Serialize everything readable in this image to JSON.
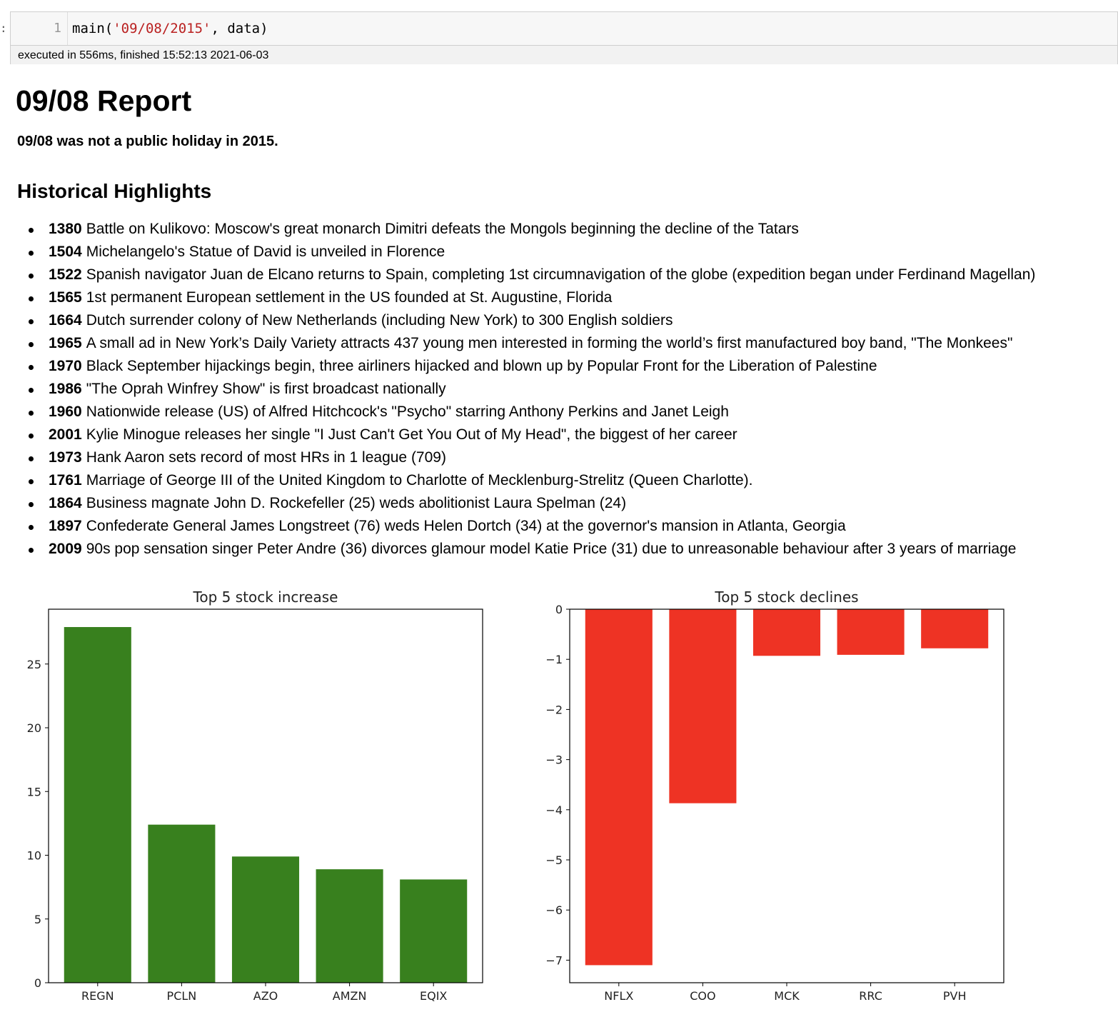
{
  "notebook": {
    "prompt_mark": ":",
    "line_number": "1",
    "code": {
      "prefix": "main(",
      "string_arg": "'09/08/2015'",
      "suffix": ", data)"
    },
    "execution_info": "executed in 556ms, finished 15:52:13 2021-06-03"
  },
  "report": {
    "title": "09/08 Report",
    "holiday_note": "09/08 was not a public holiday in 2015.",
    "highlights_heading": "Historical Highlights",
    "events": [
      {
        "year": "1380",
        "text": "Battle on Kulikovo: Moscow's great monarch Dimitri defeats the Mongols beginning the decline of the Tatars"
      },
      {
        "year": "1504",
        "text": "Michelangelo's Statue of David is unveiled in Florence"
      },
      {
        "year": "1522",
        "text": "Spanish navigator Juan de Elcano returns to Spain, completing 1st circumnavigation of the globe (expedition began under Ferdinand Magellan)"
      },
      {
        "year": "1565",
        "text": "1st permanent European settlement in the US founded at St. Augustine, Florida"
      },
      {
        "year": "1664",
        "text": "Dutch surrender colony of New Netherlands (including New York) to 300 English soldiers"
      },
      {
        "year": "1965",
        "text": "A small ad in New York’s Daily Variety attracts 437 young men interested in forming the world’s first manufactured boy band, \"The Monkees\""
      },
      {
        "year": "1970",
        "text": "Black September hijackings begin, three airliners hijacked and blown up by Popular Front for the Liberation of Palestine"
      },
      {
        "year": "1986",
        "text": "\"The Oprah Winfrey Show\" is first broadcast nationally"
      },
      {
        "year": "1960",
        "text": "Nationwide release (US) of Alfred Hitchcock's \"Psycho\" starring Anthony Perkins and Janet Leigh"
      },
      {
        "year": "2001",
        "text": "Kylie Minogue releases her single \"I Just Can't Get You Out of My Head\", the biggest of her career"
      },
      {
        "year": "1973",
        "text": "Hank Aaron sets record of most HRs in 1 league (709)"
      },
      {
        "year": "1761",
        "text": "Marriage of George III of the United Kingdom to Charlotte of Mecklenburg-Strelitz (Queen Charlotte)."
      },
      {
        "year": "1864",
        "text": "Business magnate John D. Rockefeller (25) weds abolitionist Laura Spelman (24)"
      },
      {
        "year": "1897",
        "text": "Confederate General James Longstreet (76) weds Helen Dortch (34) at the governor's mansion in Atlanta, Georgia"
      },
      {
        "year": "2009",
        "text": "90s pop sensation singer Peter Andre (36) divorces glamour model Katie Price (31) due to unreasonable behaviour after 3 years of marriage"
      }
    ]
  },
  "chart_data": [
    {
      "type": "bar",
      "title": "Top 5 stock increase",
      "categories": [
        "REGN",
        "PCLN",
        "AZO",
        "AMZN",
        "EQIX"
      ],
      "values": [
        27.9,
        12.4,
        9.9,
        8.9,
        8.1
      ],
      "ylim": [
        0,
        29.3
      ],
      "yticks": [
        0,
        5,
        10,
        15,
        20,
        25
      ],
      "color": "#38801e",
      "grid": false
    },
    {
      "type": "bar",
      "title": "Top 5 stock declines",
      "categories": [
        "NFLX",
        "COO",
        "MCK",
        "RRC",
        "PVH"
      ],
      "values": [
        -7.1,
        -3.87,
        -0.93,
        -0.91,
        -0.78
      ],
      "ylim": [
        -7.45,
        0
      ],
      "yticks": [
        0,
        -1,
        -2,
        -3,
        -4,
        -5,
        -6,
        -7
      ],
      "color": "#ee3324",
      "grid": false
    }
  ]
}
